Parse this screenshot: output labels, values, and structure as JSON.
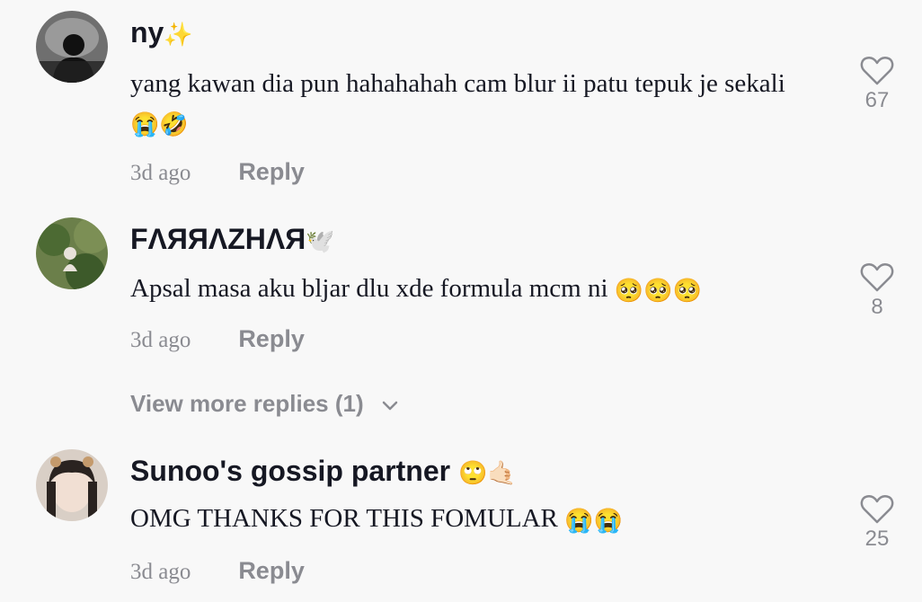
{
  "comments": [
    {
      "username": "ny",
      "username_emoji": "✨",
      "text": "yang kawan dia pun hahahahah cam blur ii patu tepuk je sekali",
      "text_emoji": "😭🤣",
      "time": "3d ago",
      "reply_label": "Reply",
      "likes": "67",
      "avatar": "silhouette-avatar"
    },
    {
      "username": "FΛЯЯΛZHΛЯ",
      "username_emoji": "🕊️",
      "text": "Apsal masa aku bljar dlu xde formula mcm ni",
      "text_emoji": "🥺🥺🥺",
      "time": "3d ago",
      "reply_label": "Reply",
      "likes": "8",
      "avatar": "nature-avatar"
    },
    {
      "username": "Sunoo's gossip partner",
      "username_emoji": "🙄🤙🏻",
      "text": "OMG THANKS FOR THIS FOMULAR",
      "text_emoji": "😭😭",
      "time": "3d ago",
      "reply_label": "Reply",
      "likes": "25",
      "avatar": "portrait-avatar"
    }
  ],
  "view_more": "View more replies (1)",
  "colors": {
    "text": "#161823",
    "secondary": "#8a8b91",
    "background": "#f8f8f8"
  }
}
